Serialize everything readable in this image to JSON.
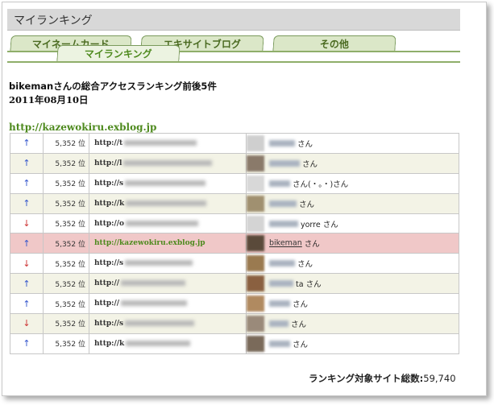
{
  "title": "マイランキング",
  "tabs": [
    {
      "label": "マイネームカード"
    },
    {
      "label": "エキサイトブログ"
    },
    {
      "label": "その他"
    },
    {
      "label": "マイランキング"
    }
  ],
  "heading": "bikemanさんの総合アクセスランキング前後5件",
  "date": "2011年08月10日",
  "site_url": "http://kazewokiru.exblog.jp",
  "rows": [
    {
      "dir": "up",
      "arrow": "↑",
      "rank": "5,352 位",
      "url": "http://t",
      "user": "",
      "san": "さん",
      "avatar": "#cfcfcf",
      "blur": 90,
      "ublur": 32
    },
    {
      "dir": "up",
      "arrow": "↑",
      "rank": "5,352 位",
      "url": "http://l",
      "user": "",
      "san": "さん",
      "avatar": "#8a7a6a",
      "blur": 110,
      "ublur": 38
    },
    {
      "dir": "up",
      "arrow": "↑",
      "rank": "5,352 位",
      "url": "http://s",
      "user": "",
      "san": "さん(・。・)さん",
      "avatar": "#d8d8d8",
      "blur": 100,
      "ublur": 26
    },
    {
      "dir": "up",
      "arrow": "↑",
      "rank": "5,352 位",
      "url": "http://k",
      "user": "",
      "san": "さん",
      "avatar": "#a09070",
      "blur": 100,
      "ublur": 34
    },
    {
      "dir": "down",
      "arrow": "↓",
      "rank": "5,352 位",
      "url": "http://o",
      "user": "",
      "san": "yorre さん",
      "avatar": "#d4d4d4",
      "blur": 90,
      "ublur": 36
    },
    {
      "dir": "up",
      "arrow": "↑",
      "rank": "5,352 位",
      "url": "http://kazewokiru.exblog.jp",
      "user": "bikeman",
      "san": "さん",
      "avatar": "#5a4a3a",
      "blur": 0,
      "ublur": 0
    },
    {
      "dir": "down",
      "arrow": "↓",
      "rank": "5,352 位",
      "url": "http://s",
      "user": "",
      "san": "さん",
      "avatar": "#9a7a50",
      "blur": 84,
      "ublur": 32
    },
    {
      "dir": "up",
      "arrow": "↑",
      "rank": "5,352 位",
      "url": "http://",
      "user": "",
      "san": "ta さん",
      "avatar": "#8a6040",
      "blur": 80,
      "ublur": 30
    },
    {
      "dir": "up",
      "arrow": "↑",
      "rank": "5,352 位",
      "url": "http://",
      "user": "",
      "san": "さん",
      "avatar": "#b08a60",
      "blur": 82,
      "ublur": 26
    },
    {
      "dir": "down",
      "arrow": "↓",
      "rank": "5,352 位",
      "url": "http://s",
      "user": "",
      "san": "さん",
      "avatar": "#9a8a7a",
      "blur": 86,
      "ublur": 24
    },
    {
      "dir": "up",
      "arrow": "↑",
      "rank": "5,352 位",
      "url": "http://k",
      "user": "",
      "san": "さん",
      "avatar": "#7a6a5a",
      "blur": 80,
      "ublur": 26
    }
  ],
  "highlight_index": 5,
  "total_label": "ランキング対象サイト総数:",
  "total_value": "59,740",
  "colors": {
    "accent": "#4e8a1e",
    "highlight_row": "#f0c8c8",
    "alt_row": "#f3f3e6",
    "up_arrow": "#3355cc",
    "down_arrow": "#cc3333"
  }
}
